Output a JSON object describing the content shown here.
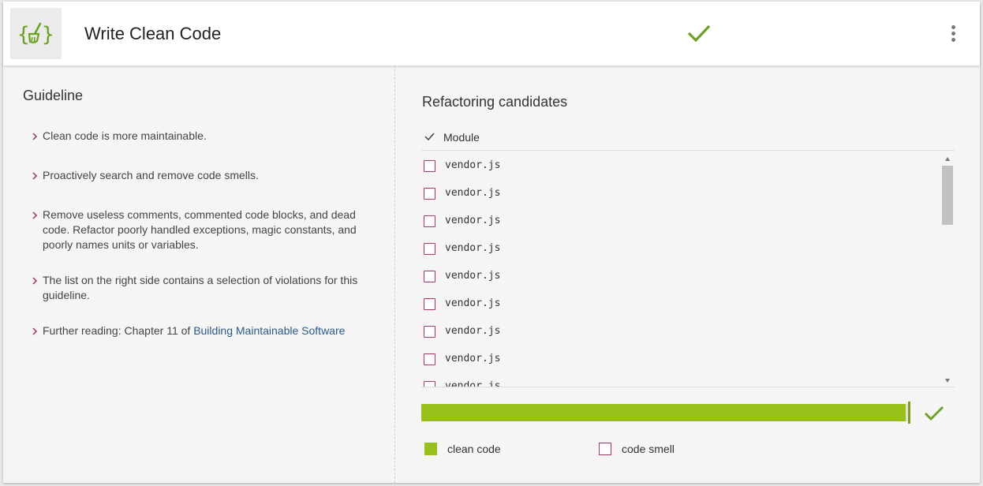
{
  "header": {
    "title": "Write Clean Code",
    "logo_icon": "code-broom-icon",
    "accent_color": "#6aa121"
  },
  "guideline": {
    "heading": "Guideline",
    "items": [
      {
        "text": "Clean code is more maintainable."
      },
      {
        "text": "Proactively search and remove code smells."
      },
      {
        "text": "Remove useless comments, commented code blocks, and dead code. Refactor poorly handled exceptions, magic constants, and poorly names units or variables."
      },
      {
        "text": "The list on the right side contains a selection of violations for this guideline."
      },
      {
        "text": "Further reading: Chapter 11 of ",
        "link": "Building Maintainable Software"
      }
    ]
  },
  "refactoring": {
    "heading": "Refactoring candidates",
    "column_header": "Module",
    "rows": [
      "vendor.js",
      "vendor.js",
      "vendor.js",
      "vendor.js",
      "vendor.js",
      "vendor.js",
      "vendor.js",
      "vendor.js",
      "vendor.js"
    ]
  },
  "progress": {
    "fraction": 0.99,
    "fill_color": "#97c11a"
  },
  "legend": {
    "clean": {
      "label": "clean code",
      "color": "#97c11a"
    },
    "smell": {
      "label": "code smell",
      "color": "#b1345a"
    }
  }
}
